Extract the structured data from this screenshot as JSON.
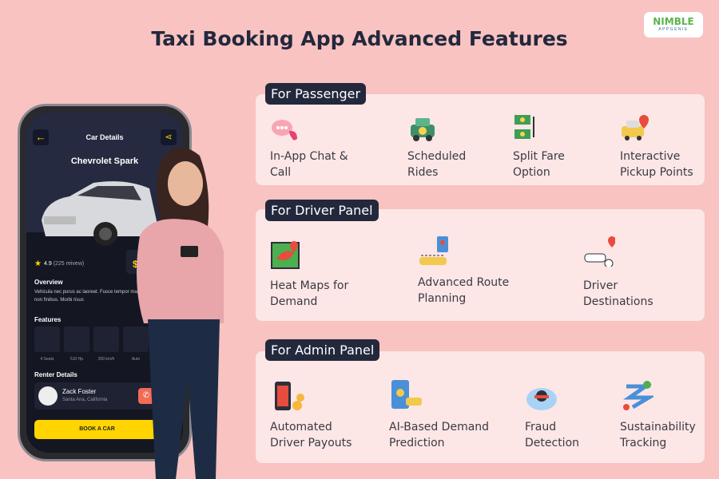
{
  "title": "Taxi Booking App Advanced Features",
  "logo": {
    "line1": "NIMBLE",
    "line2": "APPGENIE"
  },
  "phone": {
    "header": "Car Details",
    "car": "Chevrolet Spark",
    "rating": "4.9",
    "reviews": "(225 reivew)",
    "overview_title": "Overview",
    "overview_text": "Vehicula nec purus ac laoreet. Fusce tempor magna non finibus. Morbi risus",
    "features_title": "Features",
    "features": [
      "4 Seats",
      "510 Hp",
      "200 km/h",
      "Auto"
    ],
    "renter_title": "Renter Details",
    "renter_name": "Zack Foster",
    "renter_location": "Santa Ana, California",
    "book_button": "BOOK A CAR",
    "price": "$"
  },
  "sections": [
    {
      "label": "For Passenger",
      "items": [
        {
          "line1": "In-App Chat &",
          "line2": "Call",
          "icon": "chat-call-icon"
        },
        {
          "line1": "Scheduled",
          "line2": "Rides",
          "icon": "taxi-schedule-icon"
        },
        {
          "line1": "Split Fare",
          "line2": "Option",
          "icon": "split-money-icon"
        },
        {
          "line1": "Interactive",
          "line2": "Pickup Points",
          "icon": "pickup-pin-icon"
        }
      ]
    },
    {
      "label": "For Driver Panel",
      "items": [
        {
          "line1": "Heat Maps for",
          "line2": "Demand",
          "icon": "heat-map-icon"
        },
        {
          "line1": "Advanced Route",
          "line2": "Planning",
          "icon": "route-planning-icon"
        },
        {
          "line1": "Driver",
          "line2": "Destinations",
          "icon": "driver-destination-icon"
        }
      ]
    },
    {
      "label": "For Admin Panel",
      "items": [
        {
          "line1": "Automated",
          "line2": "Driver Payouts",
          "icon": "payout-icon"
        },
        {
          "line1": "AI-Based Demand",
          "line2": "Prediction",
          "icon": "ai-phone-taxi-icon"
        },
        {
          "line1": "Fraud",
          "line2": "Detection",
          "icon": "fraud-icon"
        },
        {
          "line1": "Sustainability",
          "line2": "Tracking",
          "icon": "sustainability-route-icon"
        }
      ]
    }
  ],
  "colors": {
    "background": "#f8c3c1",
    "panel": "#fde6e6",
    "tag": "#23283d",
    "accent": "#ffd400"
  }
}
